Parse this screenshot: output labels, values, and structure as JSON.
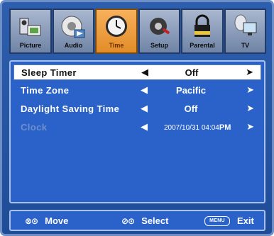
{
  "tabs": [
    {
      "label": "Picture",
      "icon": "picture-icon",
      "active": false
    },
    {
      "label": "Audio",
      "icon": "audio-icon",
      "active": false
    },
    {
      "label": "Time",
      "icon": "clock-icon",
      "active": true
    },
    {
      "label": "Setup",
      "icon": "setup-gear-icon",
      "active": false
    },
    {
      "label": "Parental",
      "icon": "lock-icon",
      "active": false
    },
    {
      "label": "TV",
      "icon": "tv-satellite-icon",
      "active": false
    }
  ],
  "menu": {
    "rows": [
      {
        "name": "Sleep Timer",
        "value": "Off",
        "selected": true
      },
      {
        "name": "Time Zone",
        "value": "Pacific"
      },
      {
        "name": "Daylight Saving Time",
        "value": "Off"
      },
      {
        "name": "Clock",
        "value_date": "2007/10/31 04:04",
        "value_ampm": "PM",
        "disabled": true
      }
    ],
    "left_arrow": "◀",
    "right_arrow": "➤"
  },
  "footer": {
    "move_icon": "⊗⊙",
    "move_label": "Move",
    "select_icon": "⊘⊙",
    "select_label": "Select",
    "menu_key": "MENU",
    "exit_label": "Exit"
  },
  "colors": {
    "background": "#2a62c9",
    "active_tab": "#f7b05b",
    "selected_row": "#ffffff"
  }
}
